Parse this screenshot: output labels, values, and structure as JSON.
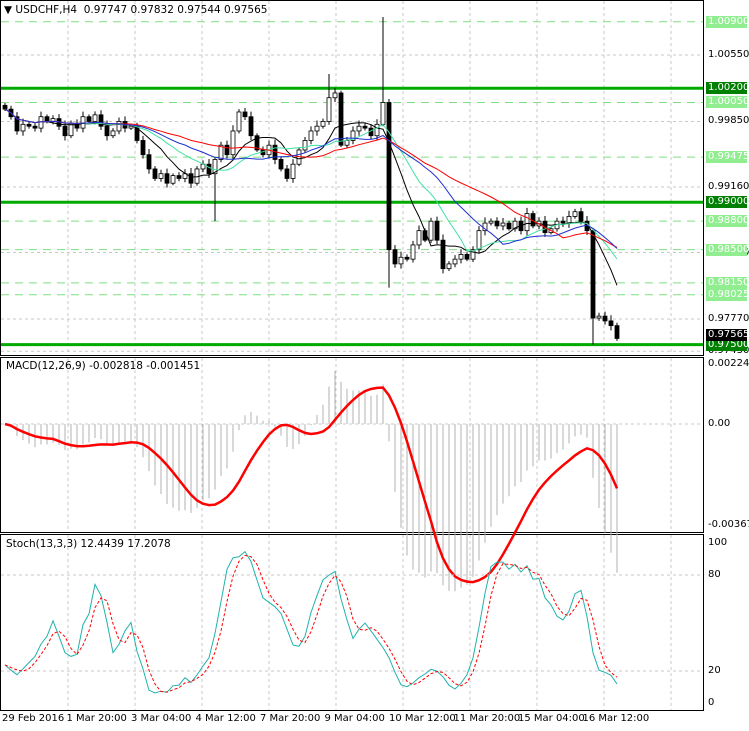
{
  "header": {
    "symbol": "USDCHF,H4",
    "open": "0.97747",
    "high": "0.97832",
    "low": "0.97544",
    "close": "0.97565"
  },
  "price_axis": {
    "ticks": [
      "1.00550",
      "0.99850",
      "0.99160",
      "0.98470",
      "0.97770",
      "0.97430"
    ],
    "last_price": "0.97565"
  },
  "levels": {
    "solid": [
      {
        "label": "1.00200",
        "price": 1.002
      },
      {
        "label": "0.99000",
        "price": 0.99
      },
      {
        "label": "0.97500",
        "price": 0.975
      }
    ],
    "dashed": [
      {
        "label": "1.00900",
        "price": 1.009
      },
      {
        "label": "1.00050",
        "price": 1.0005
      },
      {
        "label": "0.99475",
        "price": 0.99475
      },
      {
        "label": "0.98800",
        "price": 0.988
      },
      {
        "label": "0.98500",
        "price": 0.985
      },
      {
        "label": "0.98150",
        "price": 0.9815
      },
      {
        "label": "0.98025",
        "price": 0.98025
      }
    ]
  },
  "colors": {
    "solid_level": "#00aa00",
    "dashed_level": "#7fe07f",
    "label_bg": "#90ee90",
    "label_solid_bg": "#008000",
    "bull": "#ffffff",
    "bear": "#000000",
    "macd_signal": "#ff0000",
    "stoch_main": "#20b2aa",
    "stoch_signal": "#ff0000"
  },
  "macd": {
    "title": "MACD(12,26,9) -0.002818 -0.001451",
    "ticks": [
      "0.00224",
      "0.00",
      "-0.003677"
    ]
  },
  "stoch": {
    "title": "Stoch(13,3,3) 12.4439 17.2078",
    "ticks": [
      "100",
      "80",
      "20",
      "0"
    ]
  },
  "time_axis": [
    "29 Feb 2016",
    "1 Mar 20:00",
    "3 Mar 04:00",
    "4 Mar 12:00",
    "7 Mar 20:00",
    "9 Mar 04:00",
    "10 Mar 12:00",
    "11 Mar 20:00",
    "15 Mar 04:00",
    "16 Mar 12:00"
  ],
  "candles_close": [
    0.9998,
    0.999,
    0.9975,
    0.9982,
    0.998,
    0.9978,
    0.999,
    0.9985,
    0.9988,
    0.998,
    0.997,
    0.9983,
    0.9978,
    0.999,
    0.9985,
    0.9992,
    0.998,
    0.997,
    0.9975,
    0.9985,
    0.9978,
    0.998,
    0.9965,
    0.995,
    0.9935,
    0.9925,
    0.993,
    0.992,
    0.9928,
    0.9925,
    0.993,
    0.992,
    0.9935,
    0.994,
    0.993,
    0.9945,
    0.996,
    0.995,
    0.9975,
    0.9995,
    0.999,
    0.997,
    0.9955,
    0.995,
    0.996,
    0.9945,
    0.9935,
    0.9925,
    0.994,
    0.9955,
    0.9965,
    0.9975,
    0.998,
    0.9985,
    1.001,
    1.0015,
    0.996,
    0.9965,
    0.9975,
    0.998,
    0.9978,
    0.997,
    0.9982,
    1.0005,
    0.985,
    0.9835,
    0.9842,
    0.984,
    0.9855,
    0.987,
    0.986,
    0.988,
    0.986,
    0.983,
    0.9835,
    0.984,
    0.9845,
    0.984,
    0.985,
    0.987,
    0.9878,
    0.988,
    0.9875,
    0.9878,
    0.9872,
    0.988,
    0.987,
    0.9888,
    0.9875,
    0.988,
    0.9868,
    0.9872,
    0.988,
    0.9878,
    0.9885,
    0.989,
    0.988,
    0.987,
    0.9778,
    0.978,
    0.9775,
    0.977,
    0.97565
  ]
}
